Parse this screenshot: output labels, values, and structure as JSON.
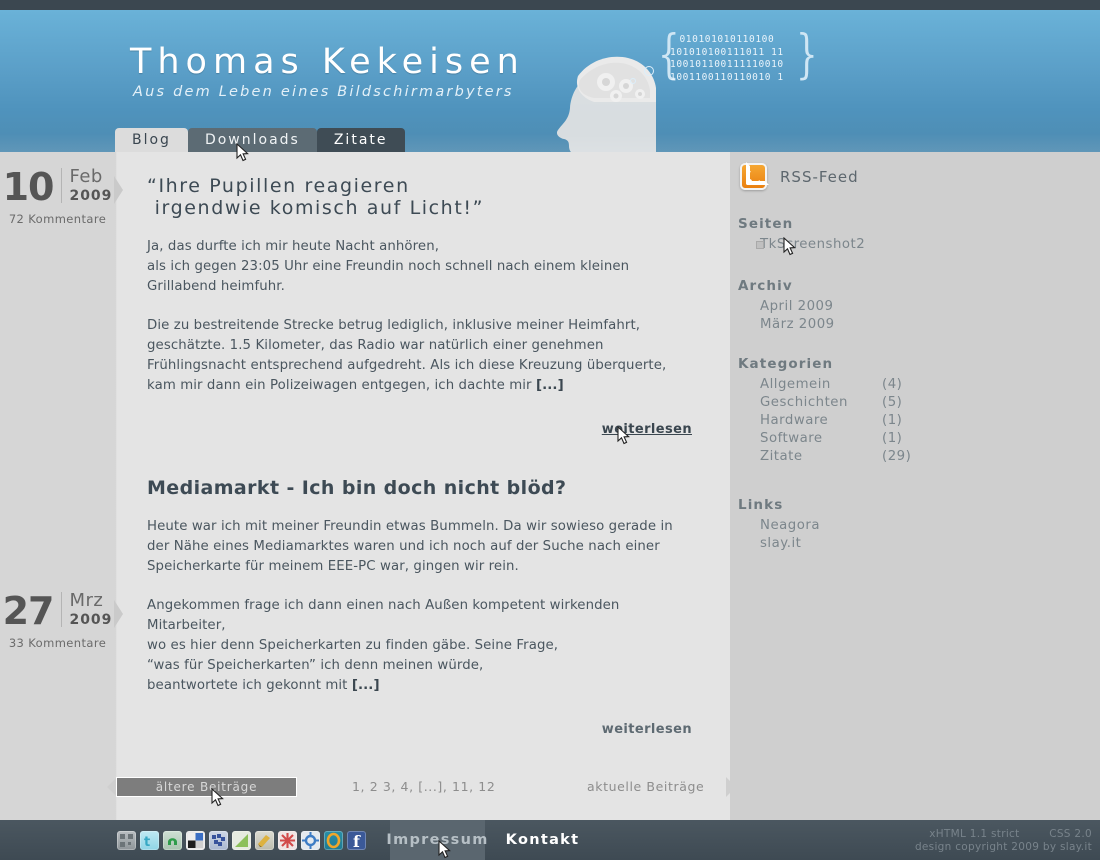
{
  "site": {
    "title": "Thomas Kekeisen",
    "subtitle": "Aus dem Leben eines Bildschirmarbyters",
    "binary": "010101010110100\n101010100111011 11\n100101100111110010\n1001100110110010 1",
    "binary_lines": [
      "010101010110100",
      "101010100111011 11",
      "100101100111110010",
      "1001100110110010 1"
    ]
  },
  "tabs": [
    {
      "label": "Blog",
      "state": "active"
    },
    {
      "label": "Downloads",
      "state": "hover"
    },
    {
      "label": "Zitate",
      "state": "normal"
    }
  ],
  "posts": [
    {
      "day": "10",
      "month": "Feb",
      "year": "2009",
      "comments": "72 Kommentare",
      "title": "“Ihre Pupillen reagieren\n irgendwie komisch auf Licht!”",
      "paragraphs": [
        "Ja, das durfte ich mir heute Nacht anhören,\nals ich gegen 23:05 Uhr eine Freundin noch schnell nach einem kleinen\nGrillabend heimfuhr.",
        "Die zu bestreitende Strecke betrug lediglich, inklusive meiner Heimfahrt,\ngeschätzte. 1.5 Kilometer, das Radio war natürlich einer genehmen\nFrühlingsnacht entsprechend aufgedreht. Als ich diese Kreuzung überquerte,\nkam mir dann ein Polizeiwagen entgegen, ich dachte mir "
      ],
      "more": "[...]",
      "readmore": "weiterlesen"
    },
    {
      "day": "27",
      "month": "Mrz",
      "year": "2009",
      "comments": "33 Kommentare",
      "title": "Mediamarkt - Ich bin doch nicht blöd?",
      "paragraphs": [
        "Heute war ich mit meiner Freundin etwas Bummeln. Da wir sowieso gerade in\nder Nähe eines Mediamarktes waren und ich noch auf der Suche nach einer\nSpeicherkarte für meinem EEE-PC war, gingen wir rein.",
        "Angekommen frage ich dann einen nach Außen kompetent wirkenden Mitarbeiter,\nwo es hier denn Speicherkarten zu finden gäbe. Seine Frage,\n“was für Speicherkarten” ich denn meinen würde,\nbeantwortete ich gekonnt mit "
      ],
      "more": "[...]",
      "readmore": "weiterlesen"
    }
  ],
  "sidebar": {
    "rss_label": "RSS-Feed",
    "pages": {
      "heading": "Seiten",
      "items": [
        {
          "label": "TkScreenshot2"
        }
      ]
    },
    "archive": {
      "heading": "Archiv",
      "items": [
        {
          "label": "April 2009"
        },
        {
          "label": "März 2009"
        }
      ]
    },
    "categories": {
      "heading": "Kategorien",
      "items": [
        {
          "label": "Allgemein",
          "count": "(4)"
        },
        {
          "label": "Geschichten",
          "count": "(5)"
        },
        {
          "label": "Hardware",
          "count": "(1)"
        },
        {
          "label": "Software",
          "count": "(1)"
        },
        {
          "label": "Zitate",
          "count": "(29)"
        }
      ]
    },
    "links": {
      "heading": "Links",
      "items": [
        {
          "label": "Neagora"
        },
        {
          "label": "slay.it"
        }
      ]
    }
  },
  "pagination": {
    "prev": "ältere Beiträge",
    "numbers": "1, 2 3, 4, [...], 11, 12",
    "next": "aktuelle Beiträge"
  },
  "footer": {
    "impressum": "Impressum",
    "kontakt": "Kontakt",
    "credit_xhtml": "xHTML 1.1 strict",
    "credit_css": "CSS 2.0",
    "credit_design": "design copyright 2009 by slay.it",
    "social": [
      {
        "name": "qr-bookmark-icon",
        "color": "#9aa0a4",
        "glyph": "▒"
      },
      {
        "name": "twitter-icon",
        "color": "#5dc8e0",
        "glyph": "t"
      },
      {
        "name": "stumbleupon-icon",
        "color": "#3aa34a",
        "glyph": "↻"
      },
      {
        "name": "delicious-icon",
        "color": "#2a2a2a",
        "glyph": "■"
      },
      {
        "name": "misterwong-icon",
        "color": "#3f6fc6",
        "glyph": "✦"
      },
      {
        "name": "yigg-icon",
        "color": "#7fbf4d",
        "glyph": "◢"
      },
      {
        "name": "linkarena-icon",
        "color": "#d8b13c",
        "glyph": "✒"
      },
      {
        "name": "technorati-icon",
        "color": "#d94b4b",
        "glyph": "✳"
      },
      {
        "name": "digg-icon",
        "color": "#4b8fd4",
        "glyph": "⚙"
      },
      {
        "name": "webnews-icon",
        "color": "#e59a22",
        "glyph": "O"
      },
      {
        "name": "facebook-icon",
        "color": "#3b5998",
        "glyph": "f"
      }
    ]
  },
  "colors": {
    "header_blue": "#5b9fc8",
    "dark_slate": "#3b4750",
    "content_bg": "#e4e4e4",
    "sidebar_bg": "#cfcfcf",
    "rss_orange": "#ea8010"
  }
}
